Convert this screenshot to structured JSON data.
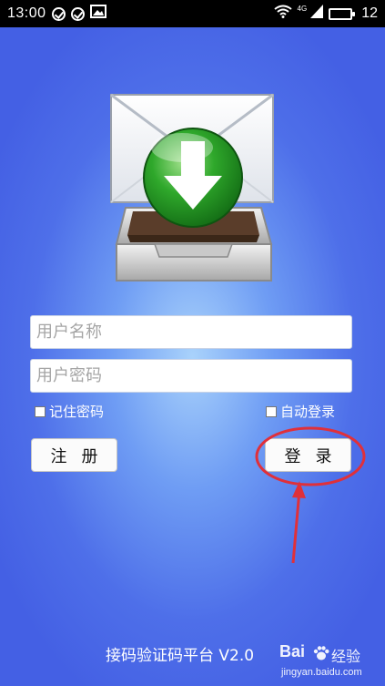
{
  "status_bar": {
    "time": "13:00",
    "network_label": "4G",
    "battery_level": "12",
    "icons": [
      "check-circle-icon",
      "check-circle-icon",
      "image-icon",
      "wifi-icon",
      "signal-icon",
      "battery-icon"
    ]
  },
  "login_form": {
    "username_placeholder": "用户名称",
    "password_placeholder": "用户密码",
    "remember_password_label": "记住密码",
    "auto_login_label": "自动登录",
    "register_label": "注册",
    "login_label": "登录"
  },
  "footer": {
    "app_title": "接码验证码平台 V2.0"
  },
  "watermark": {
    "brand": "Bai",
    "product": "经验",
    "url": "jingyan.baidu.com"
  },
  "colors": {
    "background_primary": "#4e6fe9",
    "background_glow": "#a9d2fb",
    "annotation_red": "#e0303a",
    "logo_green": "#2aa32a"
  }
}
